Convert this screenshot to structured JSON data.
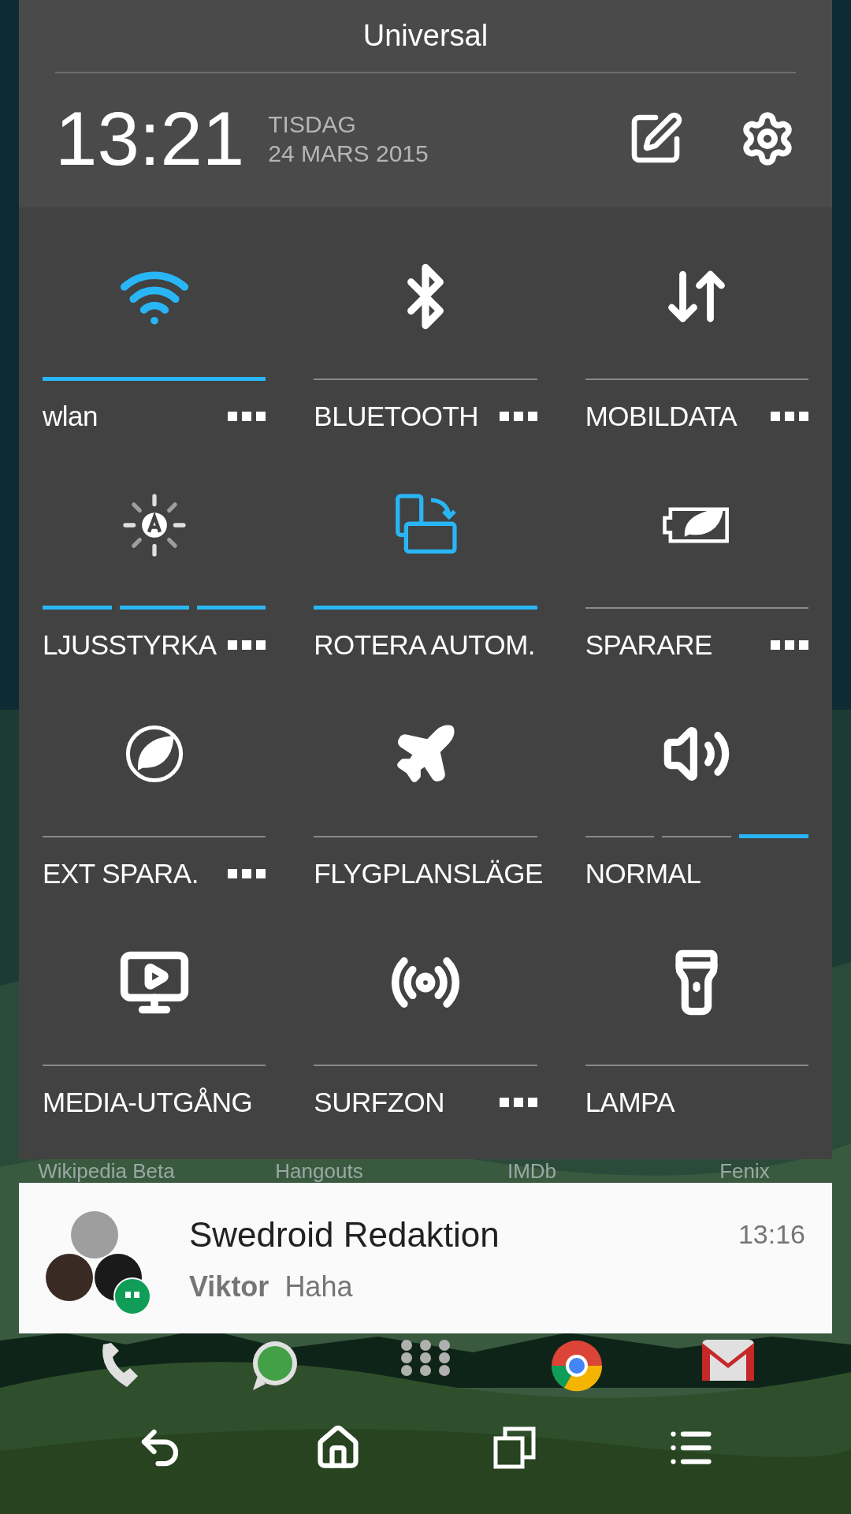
{
  "header": {
    "title": "Universal",
    "time": "13:21",
    "weekday": "TISDAG",
    "date": "24 MARS 2015"
  },
  "tiles": [
    {
      "kind": "toggle",
      "label": "wlan",
      "on": true,
      "more": true
    },
    {
      "kind": "toggle",
      "label": "BLUETOOTH",
      "on": false,
      "more": true
    },
    {
      "kind": "toggle",
      "label": "MOBILDATA",
      "on": false,
      "more": true
    },
    {
      "kind": "segmented",
      "label": "LJUSSTYRKA",
      "segments": [
        {
          "on": true
        },
        {
          "on": true
        },
        {
          "on": true
        }
      ],
      "more": true
    },
    {
      "kind": "toggle",
      "label": "ROTERA AUTOM.",
      "on": true,
      "more": false
    },
    {
      "kind": "toggle",
      "label": "SPARARE",
      "on": false,
      "more": true
    },
    {
      "kind": "toggle",
      "label": "EXT SPARA.",
      "on": false,
      "more": true
    },
    {
      "kind": "toggle",
      "label": "FLYGPLANSLÄGE",
      "on": false,
      "more": false
    },
    {
      "kind": "segmented",
      "label": "NORMAL",
      "segments": [
        {
          "on": false
        },
        {
          "on": false
        },
        {
          "on": true
        }
      ],
      "more": false
    },
    {
      "kind": "toggle",
      "label": "MEDIA-UTGÅNG",
      "on": false,
      "more": false
    },
    {
      "kind": "toggle",
      "label": "SURFZON",
      "on": false,
      "more": true
    },
    {
      "kind": "toggle",
      "label": "LAMPA",
      "on": false,
      "more": false
    }
  ],
  "home_labels": [
    "Wikipedia Beta",
    "Hangouts",
    "IMDb",
    "Fenix"
  ],
  "notification": {
    "title": "Swedroid Redaktion",
    "time": "13:16",
    "sender": "Viktor",
    "message": "Haha"
  }
}
